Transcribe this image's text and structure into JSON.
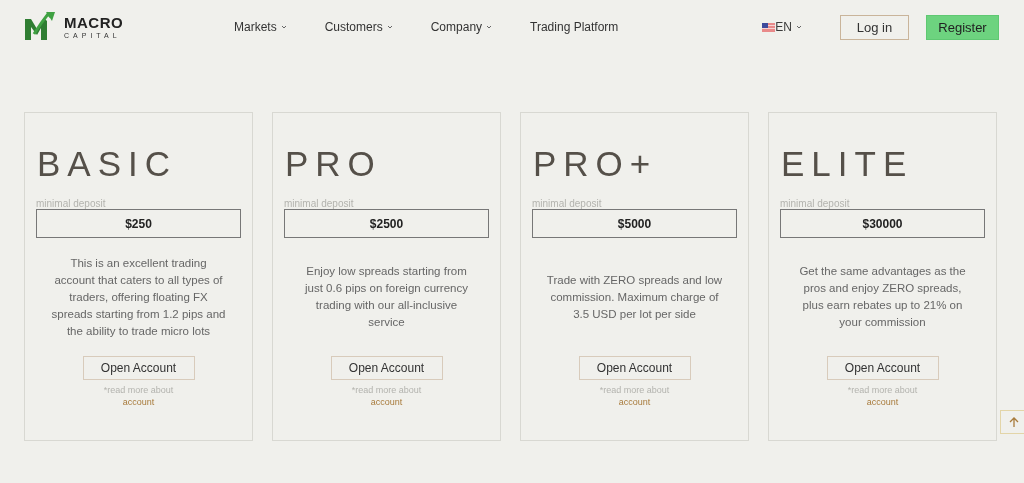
{
  "logo": {
    "name": "MACRO",
    "tagline": "CAPITAL"
  },
  "nav": [
    {
      "label": "Markets",
      "dropdown": true
    },
    {
      "label": "Customers",
      "dropdown": true
    },
    {
      "label": "Company",
      "dropdown": true
    },
    {
      "label": "Trading Platform",
      "dropdown": false
    }
  ],
  "language": {
    "label": "EN"
  },
  "login": "Log in",
  "register": "Register",
  "plans": [
    {
      "name": "BASIC",
      "deposit_label": "minimal deposit",
      "deposit": "$250",
      "description": "This is an excellent trading account that caters to all types of traders, offering floating FX spreads starting from 1.2 pips and the ability to trade micro lots",
      "button": "Open Account",
      "note": "*read more about",
      "link": "account"
    },
    {
      "name": "PRO",
      "deposit_label": "minimal deposit",
      "deposit": "$2500",
      "description": "Enjoy low spreads starting from just 0.6 pips on foreign currency trading with our all-inclusive service",
      "button": "Open Account",
      "note": "*read more about",
      "link": "account"
    },
    {
      "name": "PRO+",
      "deposit_label": "minimal deposit",
      "deposit": "$5000",
      "description": "Trade with ZERO spreads and low commission. Maximum charge of 3.5 USD per lot per side",
      "button": "Open Account",
      "note": "*read more about",
      "link": "account"
    },
    {
      "name": "ELITE",
      "deposit_label": "minimal deposit",
      "deposit": "$30000",
      "description": "Get the same advantages as the pros and enjoy ZERO spreads, plus earn rebates up to 21% on your commission",
      "button": "Open Account",
      "note": "*read more about",
      "link": "account"
    }
  ]
}
